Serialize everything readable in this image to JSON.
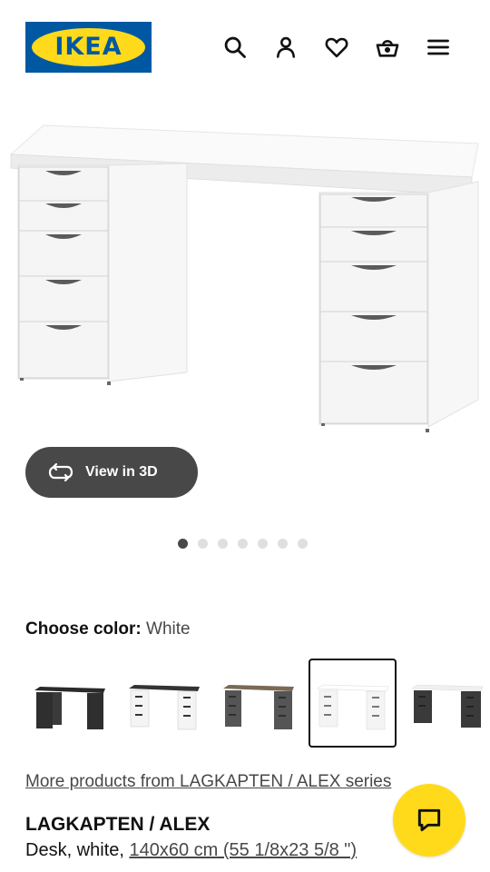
{
  "header": {
    "logo_text": "IKEA",
    "icons": [
      "search-icon",
      "account-icon",
      "heart-icon",
      "basket-icon",
      "menu-icon"
    ]
  },
  "hero": {
    "view3d_label": "View in 3D",
    "slide_count": 7,
    "active_slide": 1
  },
  "color": {
    "label": "Choose color:",
    "value": "White",
    "swatches": [
      {
        "name": "black",
        "top": "#2a2a2a",
        "body": "#2f2f2f",
        "selected": false
      },
      {
        "name": "black-white",
        "top": "#333333",
        "body": "#f4f4f4",
        "selected": false
      },
      {
        "name": "grey-turquoise",
        "top": "#7a6a55",
        "body": "#555555",
        "selected": false
      },
      {
        "name": "white",
        "top": "#ffffff",
        "body": "#f4f4f4",
        "selected": true
      },
      {
        "name": "white-black",
        "top": "#f0f0f0",
        "body": "#3a3a3a",
        "selected": false
      }
    ]
  },
  "series_link": "More products from LAGKAPTEN / ALEX series",
  "product": {
    "name": "LAGKAPTEN / ALEX",
    "desc_prefix": "Desk, white, ",
    "dimensions": "140x60 cm (55 1/8x23 5/8 \")"
  },
  "colors": {
    "brand_blue": "#0058a3",
    "brand_yellow": "#ffda1a",
    "button_dark": "#484848"
  }
}
